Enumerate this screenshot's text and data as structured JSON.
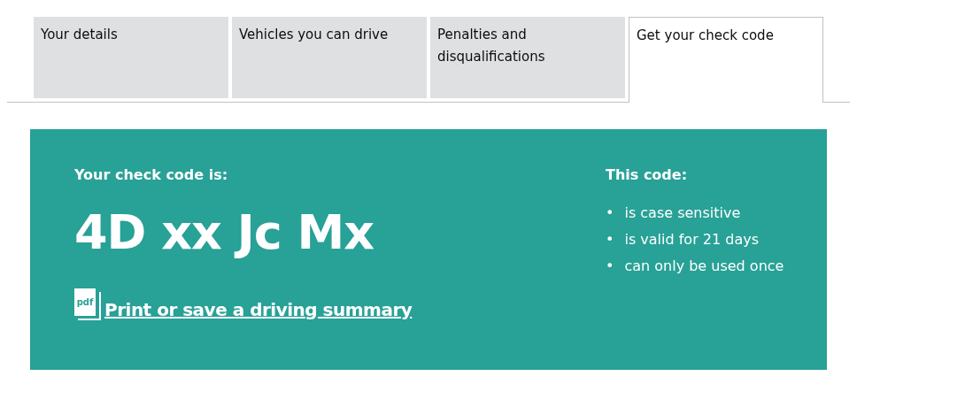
{
  "tabs": [
    {
      "label": "Your details",
      "selected": false
    },
    {
      "label": "Vehicles you can drive",
      "selected": false
    },
    {
      "label": "Penalties and disqualifications",
      "selected": false
    },
    {
      "label": "Get your check code",
      "selected": true
    }
  ],
  "check_code": {
    "label": "Your check code is:",
    "code": "4D xx Jc Mx",
    "link": {
      "icon_text": "pdf",
      "text": "Print or save a driving summary"
    }
  },
  "code_info": {
    "heading": "This code:",
    "items": [
      {
        "bullet": "•",
        "text": "is case sensitive"
      },
      {
        "bullet": "•",
        "text": "is valid for 21 days"
      },
      {
        "bullet": "•",
        "text": "can only be used once"
      }
    ]
  }
}
